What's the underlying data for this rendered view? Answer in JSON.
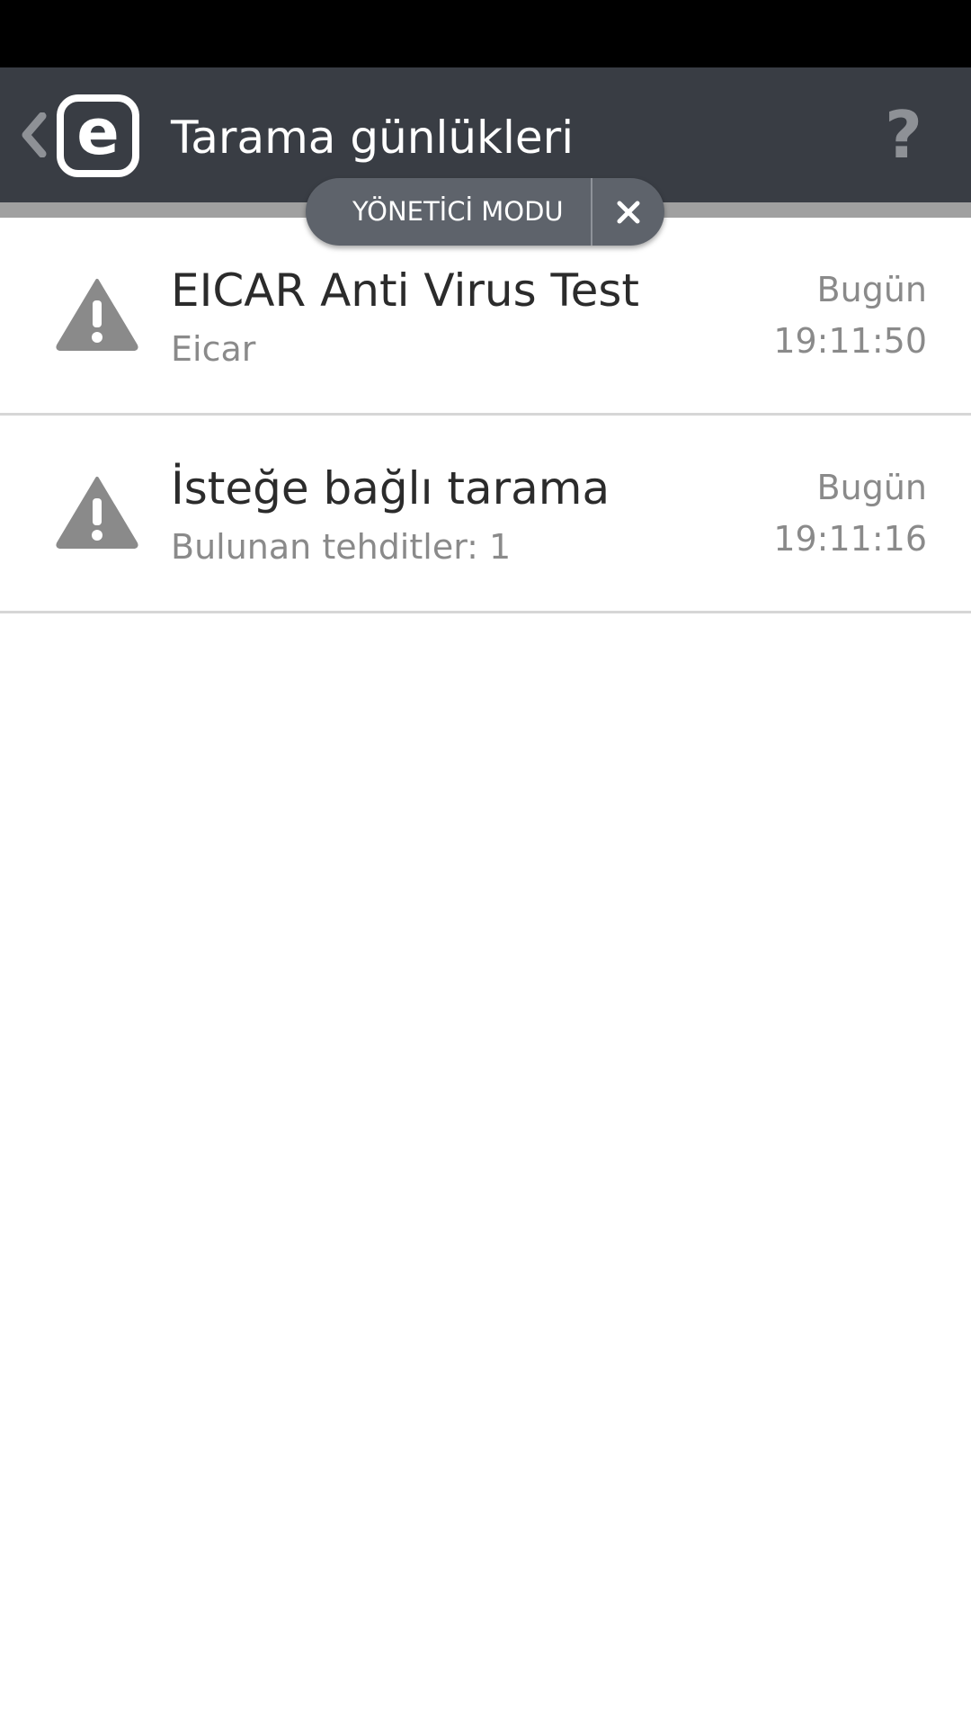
{
  "header": {
    "title": "Tarama günlükleri",
    "help_label": "?",
    "logo_letter": "e",
    "background": "#393d44"
  },
  "admin_mode": {
    "label": "YÖNETİCİ MODU"
  },
  "logs": [
    {
      "title": "EICAR Anti Virus Test",
      "subtitle": "Eicar",
      "date": "Bugün",
      "time": "19:11:50",
      "icon": "warning-icon"
    },
    {
      "title": "İsteğe bağlı tarama",
      "subtitle": "Bulunan tehditler: 1",
      "date": "Bugün",
      "time": "19:11:16",
      "icon": "warning-icon"
    }
  ]
}
